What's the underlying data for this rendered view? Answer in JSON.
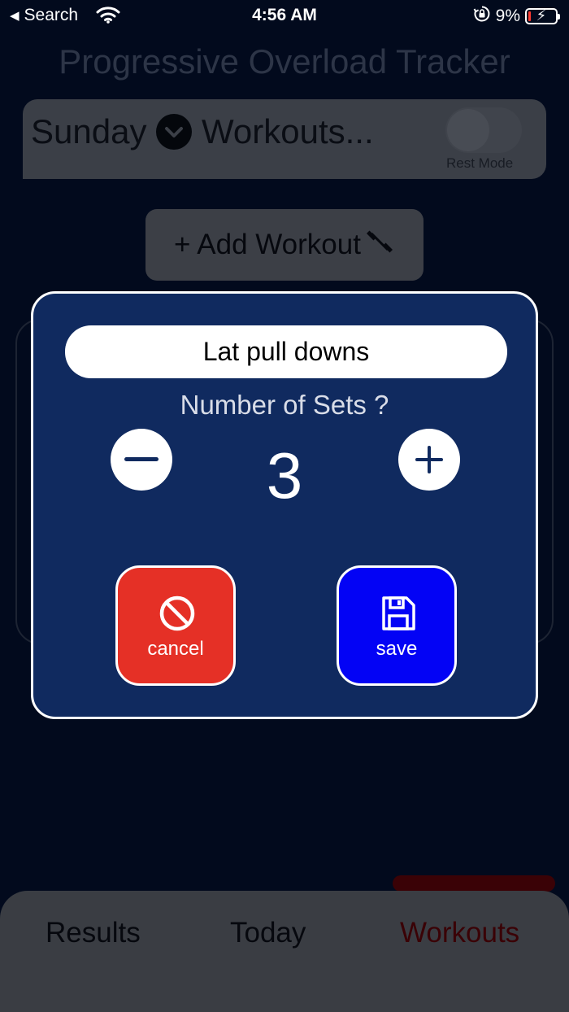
{
  "status_bar": {
    "back_label": "Search",
    "time": "4:56 AM",
    "battery_percent": "9%"
  },
  "background_app": {
    "title": "Progressive Overload Tracker",
    "day": "Sunday",
    "workouts_label": "Workouts...",
    "rest_mode_label": "Rest Mode",
    "rest_mode_on": false,
    "add_workout_label": "+ Add Workout"
  },
  "tabs": [
    {
      "label": "Results",
      "active": false
    },
    {
      "label": "Today",
      "active": false
    },
    {
      "label": "Workouts",
      "active": true
    }
  ],
  "modal": {
    "exercise_name": "Lat pull downs",
    "sets_label": "Number of Sets ?",
    "set_count": "3",
    "cancel_label": "cancel",
    "save_label": "save"
  },
  "colors": {
    "background": "#020a1d",
    "modal_background": "#102a5f",
    "cancel_button": "#e53026",
    "save_button": "#0303f5",
    "active_tab": "#3a0206"
  },
  "icons": {
    "status_back": "back-arrow-icon",
    "wifi": "wifi-icon",
    "rotation_lock": "rotation-lock-icon",
    "battery": "battery-charging-icon",
    "day_dropdown": "chevron-down-icon",
    "add_workout": "dumbbell-icon",
    "decrement": "minus-icon",
    "increment": "plus-icon",
    "cancel": "prohibited-icon",
    "save": "floppy-disk-icon"
  }
}
